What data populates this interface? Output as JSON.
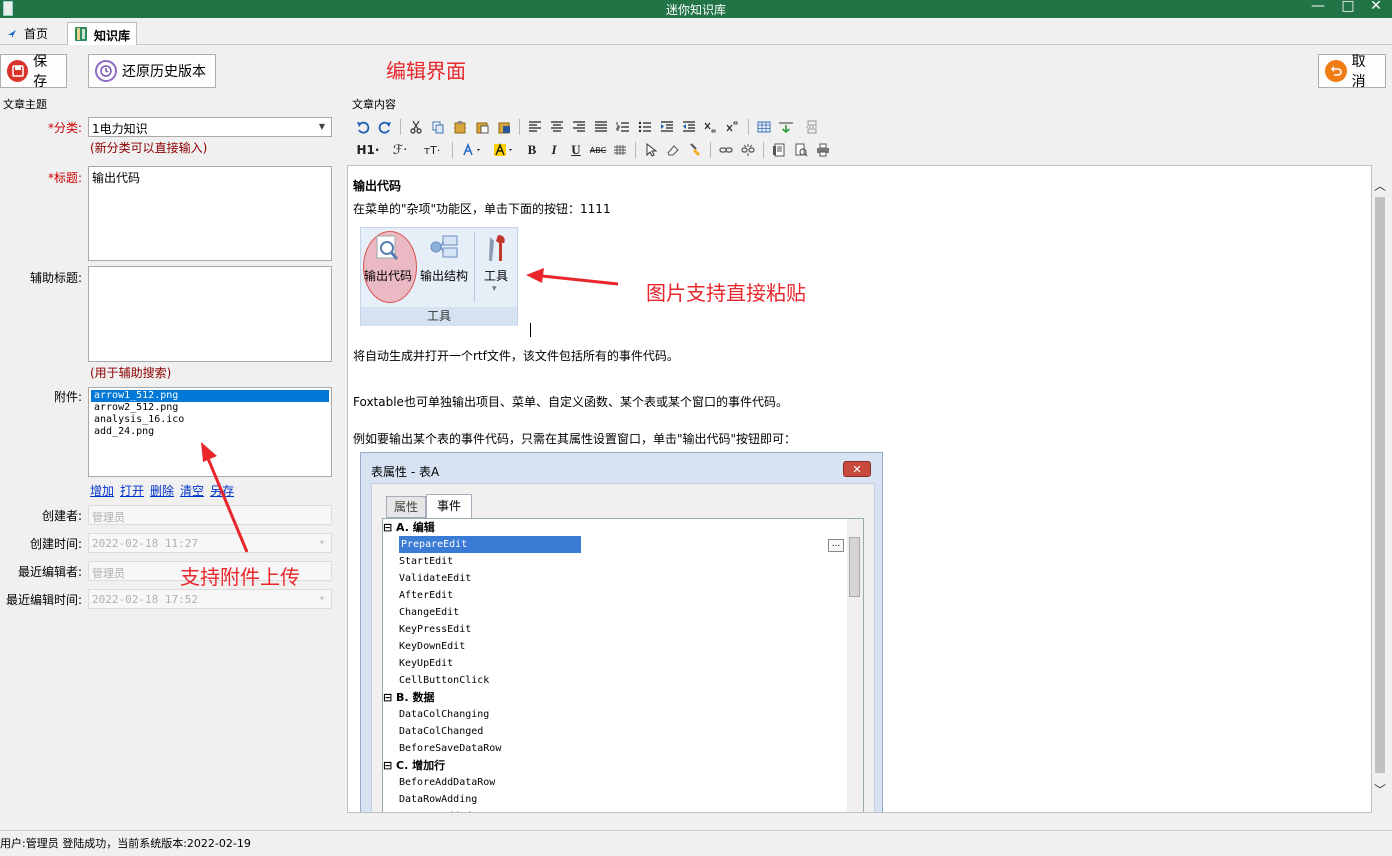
{
  "window": {
    "title": "迷你知识库",
    "minimize_glyph": "—",
    "maximize_glyph": "□",
    "close_glyph": "✕"
  },
  "tabs": [
    {
      "label": "首页",
      "icon": "pin-icon"
    },
    {
      "label": "知识库",
      "icon": "book-icon"
    }
  ],
  "toolbar": {
    "save_label": "保存",
    "restore_label": "还原历史版本",
    "cancel_label": "取消",
    "page_note": "编辑界面"
  },
  "left": {
    "section_title": "文章主题",
    "category": {
      "label": "*分类:",
      "value": "1电力知识",
      "hint": "(新分类可以直接输入)"
    },
    "title": {
      "label": "*标题:",
      "value": "输出代码"
    },
    "subtitle": {
      "label": "辅助标题:",
      "value": "",
      "hint": "(用于辅助搜索)"
    },
    "attachments": {
      "label": "附件:",
      "items": [
        "arrow1_512.png",
        "arrow2_512.png",
        "analysis_16.ico",
        "add_24.png"
      ],
      "selected_index": 0,
      "actions": [
        "增加",
        "打开",
        "删除",
        "清空",
        "另存"
      ]
    },
    "creator": {
      "label": "创建者:",
      "value": "管理员"
    },
    "created_time": {
      "label": "创建时间:",
      "value": "2022-02-18 11:27"
    },
    "editor": {
      "label": "最近编辑者:",
      "value": "管理员"
    },
    "edited_time": {
      "label": "最近编辑时间:",
      "value": "2022-02-18 17:52"
    },
    "annotation": "支持附件上传"
  },
  "content": {
    "section_title": "文章内容",
    "toolbar_row2_labels": {
      "h1": "H1·",
      "font": "ℱ·",
      "size": "тT·",
      "bold": "B",
      "italic": "I",
      "underline": "U",
      "strike": "ABC"
    },
    "heading": "输出代码",
    "para1": "在菜单的\"杂项\"功能区，单击下面的按钮：1111",
    "ribbon": {
      "btn1": "输出代码",
      "btn2": "输出结构",
      "btn3": "工具",
      "group": "工具",
      "dropdown_glyph": "▾"
    },
    "annotation": "图片支持直接粘贴",
    "para2": "将自动生成并打开一个rtf文件，该文件包括所有的事件代码。",
    "para3": "Foxtable也可单独输出项目、菜单、自定义函数、某个表或某个窗口的事件代码。",
    "para4": "例如要输出某个表的事件代码，只需在其属性设置窗口，单击\"输出代码\"按钮即可：",
    "dialog": {
      "title": "表属性 - 表A",
      "close_glyph": "✕",
      "ellipsis_glyph": "...",
      "tabs": [
        "属性",
        "事件"
      ],
      "active_tab": 1,
      "groups": [
        {
          "name": "A. 编辑",
          "items": [
            "PrepareEdit",
            "StartEdit",
            "ValidateEdit",
            "AfterEdit",
            "ChangeEdit",
            "KeyPressEdit",
            "KeyDownEdit",
            "KeyUpEdit",
            "CellButtonClick"
          ]
        },
        {
          "name": "B. 数据",
          "items": [
            "DataColChanging",
            "DataColChanged",
            "BeforeSaveDataRow"
          ]
        },
        {
          "name": "C. 增加行",
          "items": [
            "BeforeAddDataRow",
            "DataRowAdding",
            "DataRowAdded"
          ]
        }
      ]
    }
  },
  "status": {
    "text": "用户:管理员  登陆成功，当前系统版本:2022-02-19"
  },
  "colors": {
    "titlebar": "#227447",
    "annotation": "#e8262b",
    "hint": "#8b0000",
    "selection": "#0078d7"
  }
}
